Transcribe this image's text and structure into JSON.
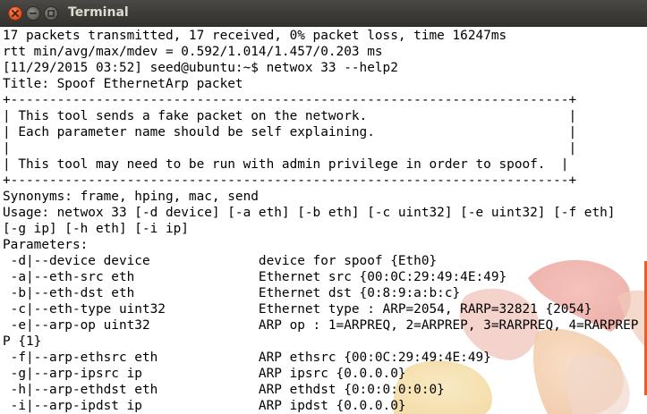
{
  "window": {
    "title": "Terminal"
  },
  "terminal": {
    "lines": [
      "17 packets transmitted, 17 received, 0% packet loss, time 16247ms",
      "rtt min/avg/max/mdev = 0.592/1.014/1.457/0.203 ms",
      "[11/29/2015 03:52] seed@ubuntu:~$ netwox 33 --help2",
      "Title: Spoof EthernetArp packet",
      "+------------------------------------------------------------------------+",
      "| This tool sends a fake packet on the network.                          |",
      "| Each parameter name should be self explaining.                         |",
      "|                                                                        |",
      "| This tool may need to be run with admin privilege in order to spoof.  |",
      "+------------------------------------------------------------------------+",
      "Synonyms: frame, hping, mac, send",
      "Usage: netwox 33 [-d device] [-a eth] [-b eth] [-c uint32] [-e uint32] [-f eth]",
      "[-g ip] [-h eth] [-i ip]",
      "Parameters:",
      " -d|--device device              device for spoof {Eth0}",
      " -a|--eth-src eth                Ethernet src {00:0C:29:49:4E:49}",
      " -b|--eth-dst eth                Ethernet dst {0:8:9:a:b:c}",
      " -c|--eth-type uint32            Ethernet type : ARP=2054, RARP=32821 {2054}",
      " -e|--arp-op uint32              ARP op : 1=ARPREQ, 2=ARPREP, 3=RARPREQ, 4=RARPREP",
      "P {1}",
      " -f|--arp-ethsrc eth             ARP ethsrc {00:0C:29:49:4E:49}",
      " -g|--arp-ipsrc ip               ARP ipsrc {0.0.0.0}",
      " -h|--arp-ethdst eth             ARP ethdst {0:0:0:0:0:0}",
      " -i|--arp-ipdst ip               ARP ipdst {0.0.0.0}"
    ]
  },
  "colors": {
    "titlebar": "#3c3b37",
    "title_text": "#dfdbd2",
    "close_button": "#e45a25",
    "terminal_bg": "#ffffff",
    "terminal_text": "#000000",
    "accent": "#e95f2a"
  },
  "icons": {
    "close": "close-icon",
    "minimize": "minimize-icon",
    "maximize": "maximize-icon"
  }
}
